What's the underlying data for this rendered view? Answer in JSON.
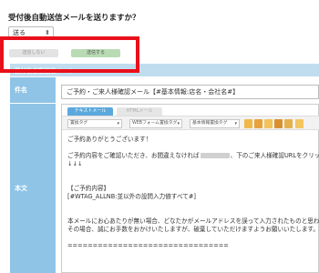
{
  "question": "受付後自動送信メールを送りますか？",
  "select": {
    "value": "送る"
  },
  "toggle": {
    "off_label": "送信しない",
    "on_label": "送信する"
  },
  "section_title": "受付後自動送信メール",
  "labels": {
    "subject": "件名",
    "body": "本文"
  },
  "subject_value": "ご予約・ご来人様確認メール【#基本情報:店名・会社名#】",
  "editor": {
    "tabs": {
      "text": "テキストメール",
      "html": "HTMLメール"
    },
    "toolbar": {
      "select1": "置換タグ",
      "select2": "WEBフォーム置換タグ",
      "select3": "基本情報置換タグ"
    },
    "body_lines": {
      "l1": "ご予約ありがとうございます！",
      "l2a": "ご予約内容をご確認いただき、お間違えなければ",
      "l2b": "、下のご来人様確認URLをクリックしてくだ",
      "l3": "↓↓↓",
      "l4": "【ご予約内容】",
      "l5": "[#WTAG_ALLNB:並以外の設問入力値すべて#]",
      "l6": "本メールにお心あたりが無い場合、どなたかがメールアドレスを誤って入力されたものと思われ",
      "l7": "その場合、誠にお手数をおかけいたしますが、破棄していただけますようお願いいたします。",
      "l8": "================================"
    }
  },
  "colors": {
    "accent_red": "#e8101a",
    "label_blue": "#8fc4e7",
    "section_blue": "#c0ddf0",
    "tab_blue": "#5aa8dc",
    "toggle_green": "#b8dbb4"
  }
}
